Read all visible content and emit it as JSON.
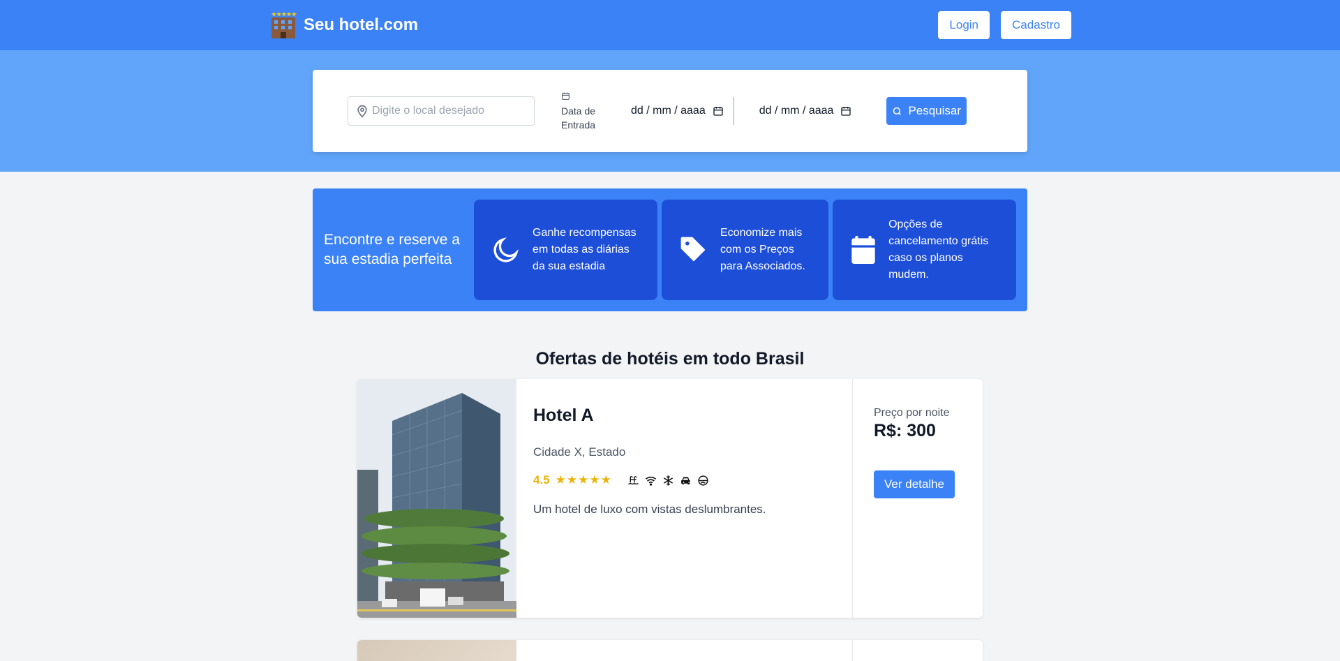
{
  "header": {
    "brand": "Seu hotel.com",
    "login_label": "Login",
    "signup_label": "Cadastro",
    "accent_color": "#3b82f6"
  },
  "search": {
    "location_placeholder": "Digite o local desejado",
    "date_label": "Data de Entrada",
    "checkin_format": "dd / mm / aaaa",
    "checkout_format": "dd / mm / aaaa",
    "button_label": "Pesquisar"
  },
  "features": {
    "title": "Encontre e reserve a sua estadia perfeita",
    "items": [
      {
        "icon": "moon-icon",
        "text": "Ganhe recompensas em todas as diárias da sua estadia"
      },
      {
        "icon": "tag-icon",
        "text": "Economize mais com os Preços para Associados."
      },
      {
        "icon": "calendar-icon",
        "text": "Opções de cancelamento grátis caso os planos mudem."
      }
    ]
  },
  "offers": {
    "title": "Ofertas de hotéis em todo Brasil",
    "hotels": [
      {
        "name": "Hotel A",
        "location": "Cidade X, Estado",
        "rating": "4.5",
        "stars": "★★★★★",
        "amenities": [
          "pool-icon",
          "wifi-icon",
          "snowflake-icon",
          "car-icon",
          "hot-tub-icon"
        ],
        "description": "Um hotel de luxo com vistas deslumbrantes.",
        "price_label": "Preço por noite",
        "price": "R$: 300",
        "detail_label": "Ver detalhe"
      }
    ]
  }
}
